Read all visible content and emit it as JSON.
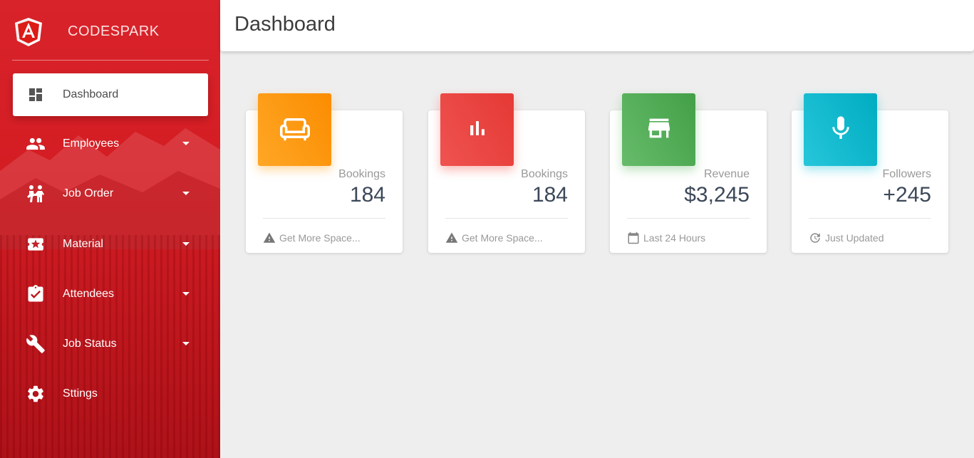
{
  "brand": {
    "name": "CODESPARK",
    "logo_icon": "angular-logo-icon"
  },
  "header": {
    "title": "Dashboard"
  },
  "sidebar": {
    "items": [
      {
        "label": "Dashboard",
        "icon": "dashboard-icon",
        "active": true,
        "expandable": false
      },
      {
        "label": "Employees",
        "icon": "people-icon",
        "active": false,
        "expandable": true
      },
      {
        "label": "Job Order",
        "icon": "workers-icon",
        "active": false,
        "expandable": true
      },
      {
        "label": "Material",
        "icon": "ticket-star-icon",
        "active": false,
        "expandable": true
      },
      {
        "label": "Attendees",
        "icon": "clipboard-check-icon",
        "active": false,
        "expandable": true
      },
      {
        "label": "Job Status",
        "icon": "wrench-icon",
        "active": false,
        "expandable": true
      },
      {
        "label": "Sttings",
        "icon": "gear-icon",
        "active": false,
        "expandable": false
      }
    ]
  },
  "cards": [
    {
      "label": "Bookings",
      "value": "184",
      "footer": "Get More Space...",
      "tile_icon": "sofa-icon",
      "footer_icon": "warning-icon",
      "color": "#fb8c00"
    },
    {
      "label": "Bookings",
      "value": "184",
      "footer": "Get More Space...",
      "tile_icon": "bar-chart-icon",
      "footer_icon": "warning-icon",
      "color": "#e53935"
    },
    {
      "label": "Revenue",
      "value": "$3,245",
      "footer": "Last 24 Hours",
      "tile_icon": "store-icon",
      "footer_icon": "calendar-icon",
      "color": "#43a047"
    },
    {
      "label": "Followers",
      "value": "+245",
      "footer": "Just Updated",
      "tile_icon": "microphone-icon",
      "footer_icon": "update-icon",
      "color": "#00acc1"
    }
  ]
}
